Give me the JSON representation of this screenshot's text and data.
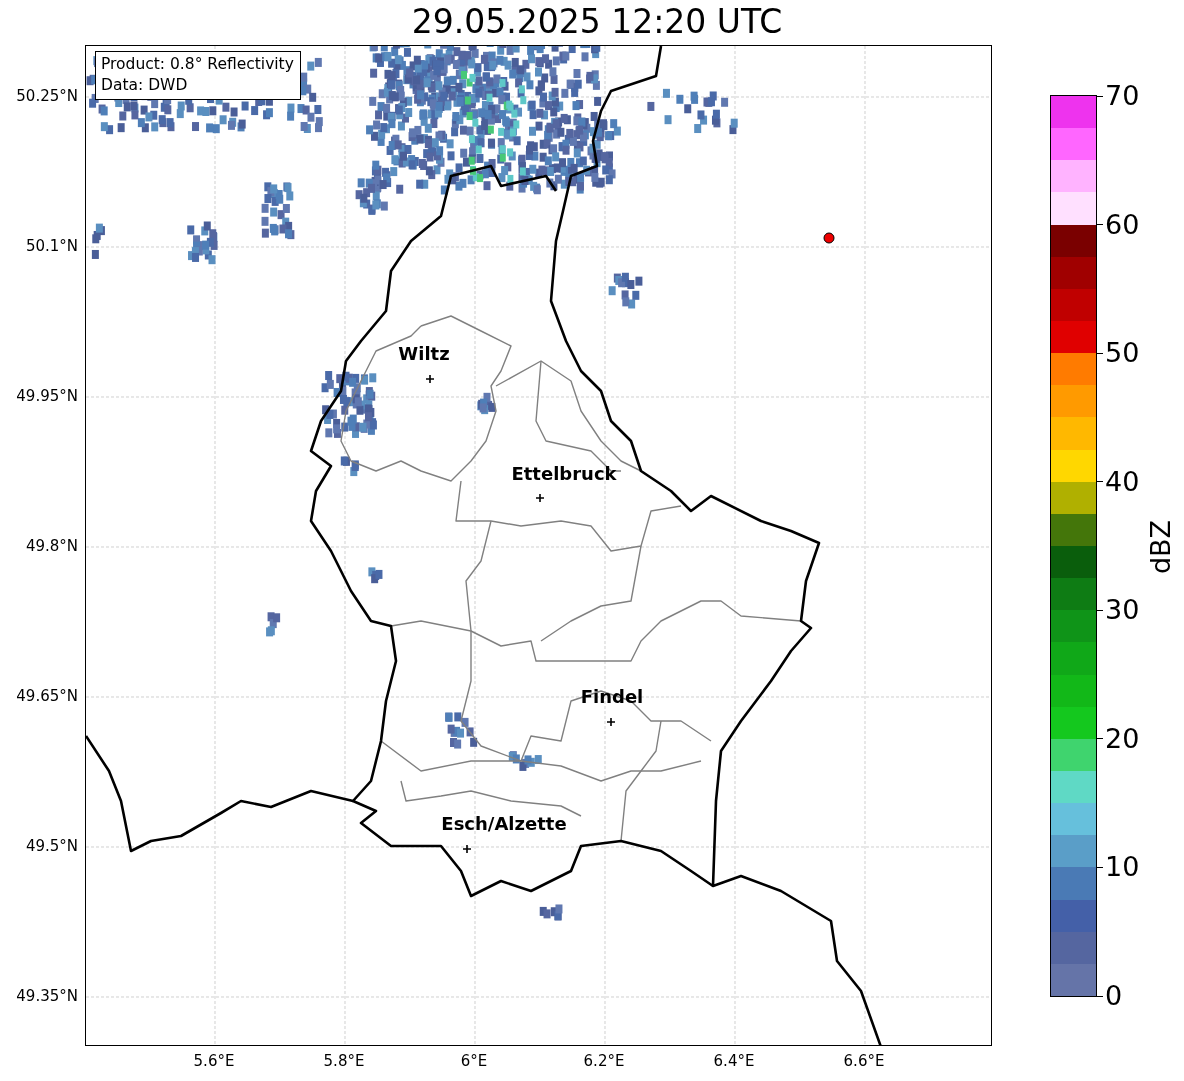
{
  "title": "29.05.2025 12:20 UTC",
  "info_box": {
    "lines": [
      "Product: 0.8° Reflectivity",
      "Data: DWD"
    ]
  },
  "map": {
    "x_ticks": [
      "5.6°E",
      "5.8°E",
      "6°E",
      "6.2°E",
      "6.4°E",
      "6.6°E"
    ],
    "y_ticks": [
      "50.25°N",
      "50.1°N",
      "49.95°N",
      "49.8°N",
      "49.65°N",
      "49.5°N",
      "49.35°N"
    ],
    "cities": [
      {
        "name": "Wiltz"
      },
      {
        "name": "Ettelbruck"
      },
      {
        "name": "Findel"
      },
      {
        "name": "Esch/Alzette"
      }
    ]
  },
  "colorbar": {
    "label": "dBZ",
    "ticks": [
      "70",
      "60",
      "50",
      "40",
      "30",
      "20",
      "10",
      "0"
    ],
    "segments": [
      {
        "color": "#ee33ee"
      },
      {
        "color": "#ff66ff"
      },
      {
        "color": "#ffb3ff"
      },
      {
        "color": "#ffe0ff"
      },
      {
        "color": "#7a0000"
      },
      {
        "color": "#a00000"
      },
      {
        "color": "#c00000"
      },
      {
        "color": "#e00000"
      },
      {
        "color": "#ff7b00"
      },
      {
        "color": "#ff9a00"
      },
      {
        "color": "#ffb800"
      },
      {
        "color": "#ffd700"
      },
      {
        "color": "#b0b000"
      },
      {
        "color": "#44760a"
      },
      {
        "color": "#0a5e0c"
      },
      {
        "color": "#0e7c14"
      },
      {
        "color": "#0f9418"
      },
      {
        "color": "#10a818"
      },
      {
        "color": "#12b818"
      },
      {
        "color": "#14c81e"
      },
      {
        "color": "#3fd46e"
      },
      {
        "color": "#5fd9c5"
      },
      {
        "color": "#66c0dc"
      },
      {
        "color": "#5a9ec8"
      },
      {
        "color": "#4a7ab5"
      },
      {
        "color": "#4460a8"
      },
      {
        "color": "#5566a0"
      },
      {
        "color": "#6574a8"
      }
    ]
  }
}
